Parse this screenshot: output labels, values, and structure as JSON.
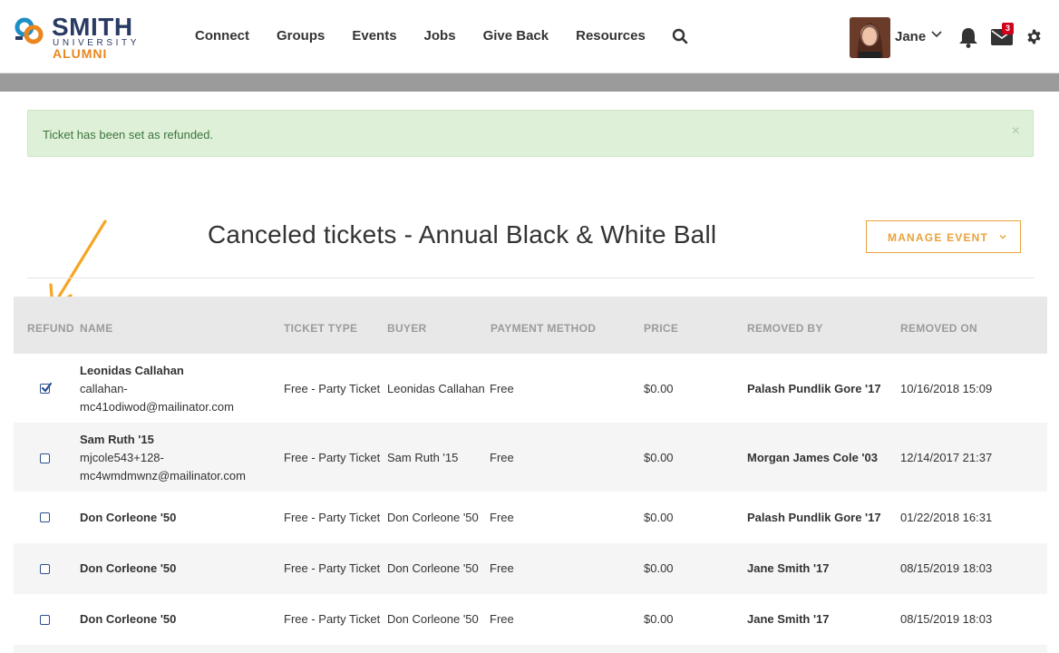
{
  "brand": {
    "name": "SMITH",
    "sub": "UNIVERSITY",
    "alumni": "ALUMNI",
    "colors": {
      "navy": "#2a3b63",
      "orange": "#e9861f",
      "blue": "#1e8fc6"
    }
  },
  "nav": {
    "items": [
      "Connect",
      "Groups",
      "Events",
      "Jobs",
      "Give Back",
      "Resources"
    ],
    "search_icon": "search-icon"
  },
  "user": {
    "name": "Jane",
    "mail_count": "3"
  },
  "alert": {
    "text": "Ticket has been set as refunded.",
    "close": "×"
  },
  "page": {
    "title": "Canceled tickets - Annual Black & White Ball",
    "manage_button": "MANAGE EVENT"
  },
  "table": {
    "headers": [
      "REFUND",
      "NAME",
      "TICKET TYPE",
      "BUYER",
      "PAYMENT METHOD",
      "PRICE",
      "REMOVED BY",
      "REMOVED ON"
    ],
    "rows": [
      {
        "refunded": true,
        "name": "Leonidas Callahan",
        "email1": "callahan-",
        "email2": "mc41odiwod@mailinator.com",
        "ticket_type": "Free - Party Ticket",
        "buyer": "Leonidas Callahan",
        "payment": "Free",
        "price": "$0.00",
        "removed_by": "Palash Pundlik Gore '17",
        "removed_on": "10/16/2018 15:09"
      },
      {
        "refunded": false,
        "name": "Sam Ruth '15",
        "email1": "mjcole543+128-",
        "email2": "mc4wmdmwnz@mailinator.com",
        "ticket_type": "Free - Party Ticket",
        "buyer": "Sam Ruth '15",
        "payment": "Free",
        "price": "$0.00",
        "removed_by": "Morgan James Cole '03",
        "removed_on": "12/14/2017 21:37"
      },
      {
        "refunded": false,
        "name": "Don Corleone '50",
        "ticket_type": "Free - Party Ticket",
        "buyer": "Don Corleone '50",
        "payment": "Free",
        "price": "$0.00",
        "removed_by": "Palash Pundlik Gore '17",
        "removed_on": "01/22/2018 16:31"
      },
      {
        "refunded": false,
        "name": "Don Corleone '50",
        "ticket_type": "Free - Party Ticket",
        "buyer": "Don Corleone '50",
        "payment": "Free",
        "price": "$0.00",
        "removed_by": "Jane Smith '17",
        "removed_on": "08/15/2019 18:03"
      },
      {
        "refunded": false,
        "name": "Don Corleone '50",
        "ticket_type": "Free - Party Ticket",
        "buyer": "Don Corleone '50",
        "payment": "Free",
        "price": "$0.00",
        "removed_by": "Jane Smith '17",
        "removed_on": "08/15/2019 18:03"
      }
    ]
  },
  "annotation": {
    "arrow_color": "#f5a623"
  }
}
